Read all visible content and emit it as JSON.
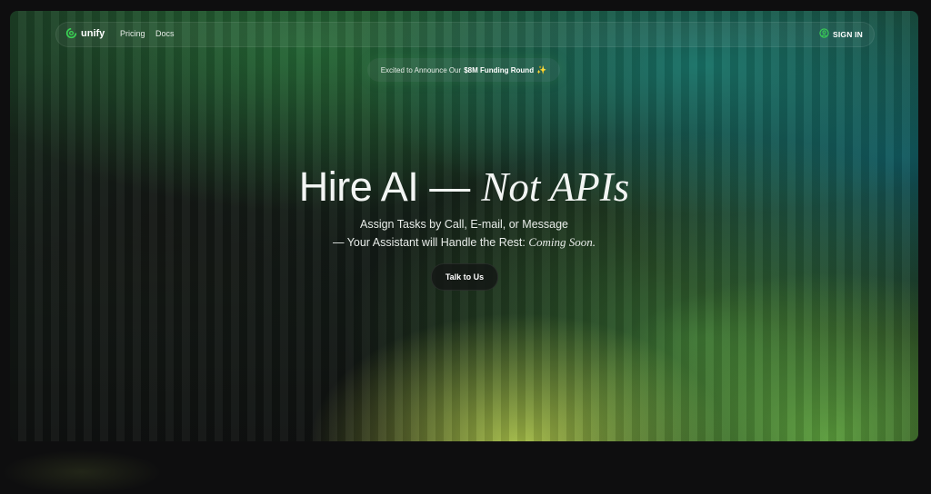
{
  "nav": {
    "brand": "unify",
    "links": [
      "Pricing",
      "Docs"
    ],
    "signin_label": "SIGN IN"
  },
  "announcement": {
    "prefix": "Excited to Announce Our",
    "highlight": "$8M Funding Round",
    "sparkle": "✨"
  },
  "hero": {
    "headline_part1": "Hire AI —",
    "headline_part2": "Not APIs",
    "subline1": "Assign Tasks by Call, E-mail, or Message",
    "subline2": "— Your Assistant will Handle the Rest:",
    "subline2_emphasis": "Coming Soon.",
    "cta_label": "Talk to Us"
  },
  "colors": {
    "brand_green": "#39d353",
    "text": "#ffffff"
  },
  "icons": {
    "brand": "unify-logo-icon",
    "signin": "user-circle-icon",
    "announcement": "sparkle-icon"
  }
}
